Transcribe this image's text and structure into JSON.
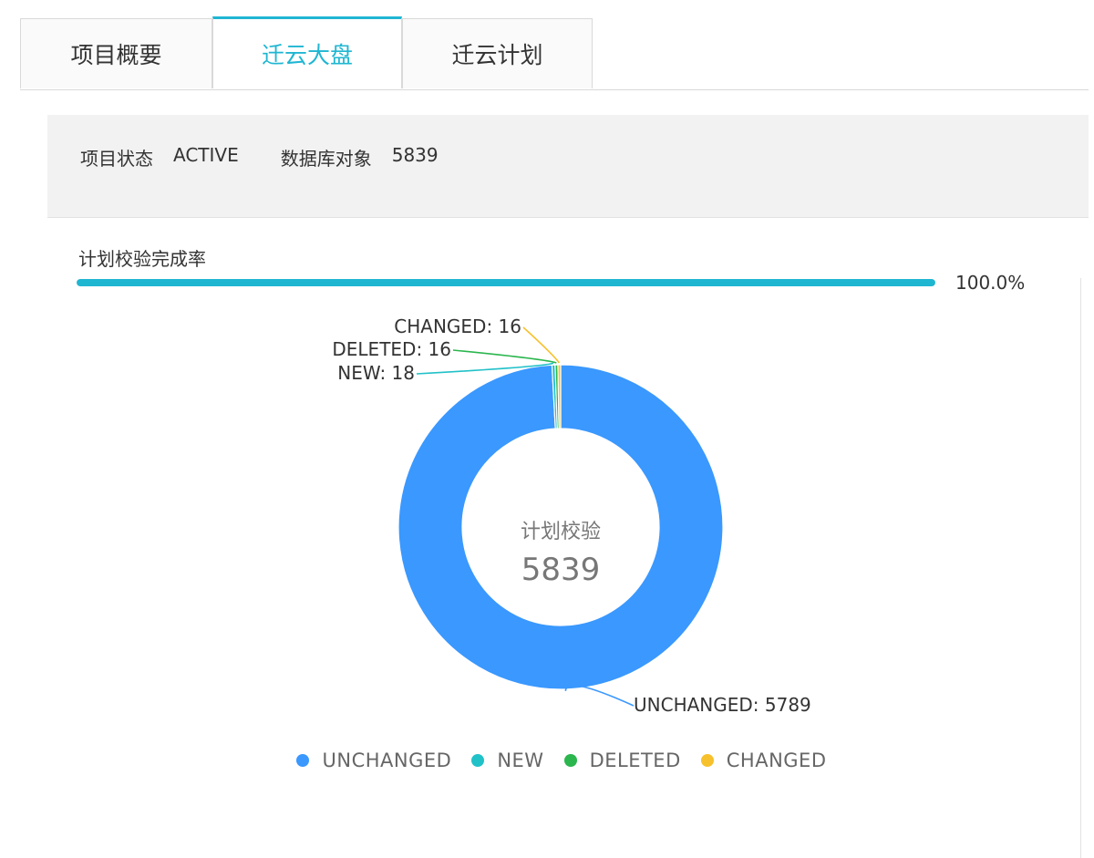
{
  "tabs": [
    {
      "label": "项目概要",
      "active": false
    },
    {
      "label": "迁云大盘",
      "active": true
    },
    {
      "label": "迁云计划",
      "active": false
    }
  ],
  "info": {
    "status_label": "项目状态",
    "status_value": "ACTIVE",
    "db_label": "数据库对象",
    "db_value": "5839"
  },
  "progress": {
    "title": "计划校验完成率",
    "percent_text": "100.0%",
    "value": 1.0
  },
  "chart_data": {
    "type": "pie",
    "subtype": "donut",
    "center_label": "计划校验",
    "center_value": "5839",
    "slices": [
      {
        "name": "UNCHANGED",
        "value": 5789,
        "color": "#3a98ff",
        "label": "UNCHANGED: 5789"
      },
      {
        "name": "NEW",
        "value": 18,
        "color": "#21c1c8",
        "label": "NEW: 18"
      },
      {
        "name": "DELETED",
        "value": 16,
        "color": "#2bb64e",
        "label": "DELETED: 16"
      },
      {
        "name": "CHANGED",
        "value": 16,
        "color": "#f7c12d",
        "label": "CHANGED: 16"
      }
    ],
    "legend": [
      "UNCHANGED",
      "NEW",
      "DELETED",
      "CHANGED"
    ],
    "legend_position": "bottom"
  },
  "colors": {
    "accent": "#1fb6d2",
    "panel_bg": "#f2f2f2"
  }
}
